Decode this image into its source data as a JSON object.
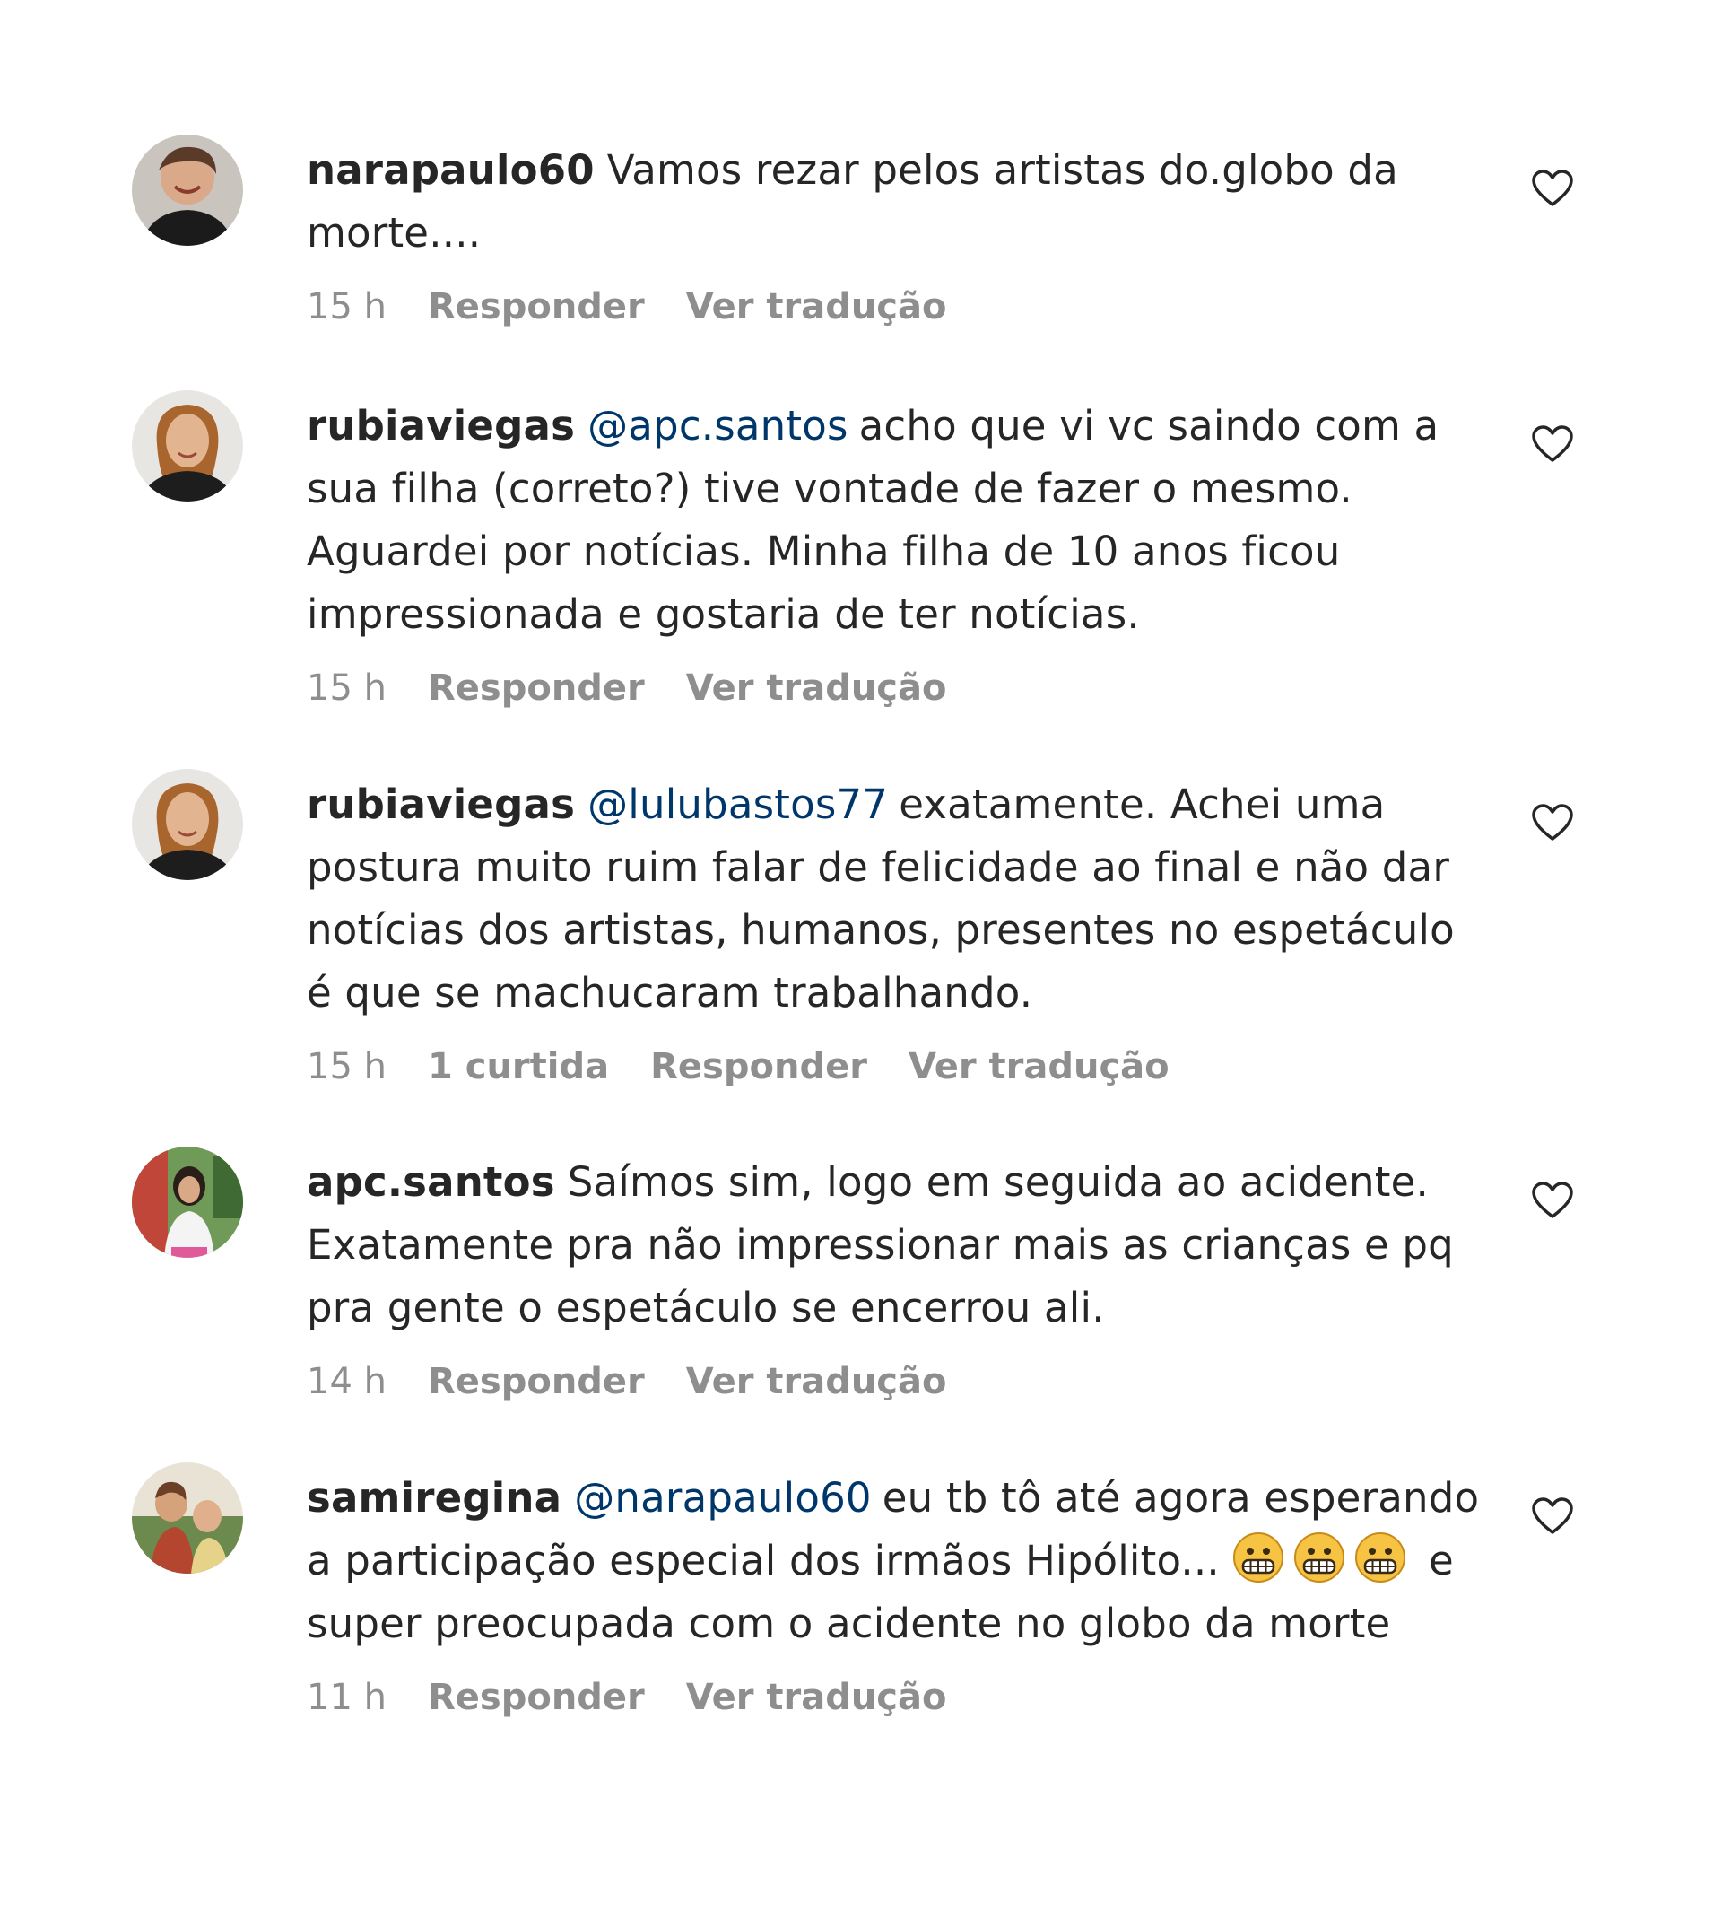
{
  "comments": [
    {
      "username": "narapaulo60",
      "mention": "",
      "text": "Vamos rezar pelos artistas do.globo da morte....",
      "time": "15 h",
      "likes": "",
      "reply_label": "Responder",
      "translate_label": "Ver tradução"
    },
    {
      "username": "rubiaviegas",
      "mention": "@apc.santos",
      "text": "acho que vi vc saindo com a sua filha (correto?) tive vontade de fazer o mesmo. Aguardei por notícias. Minha filha de 10 anos ficou impressionada e gostaria de ter notícias.",
      "time": "15 h",
      "likes": "",
      "reply_label": "Responder",
      "translate_label": "Ver tradução"
    },
    {
      "username": "rubiaviegas",
      "mention": "@lulubastos77",
      "text": "exatamente. Achei uma postura muito ruim falar de felicidade ao final e não dar notícias dos artistas, humanos, presentes no espetáculo é que se machucaram trabalhando.",
      "time": "15 h",
      "likes": "1 curtida",
      "reply_label": "Responder",
      "translate_label": "Ver tradução"
    },
    {
      "username": "apc.santos",
      "mention": "",
      "text": "Saímos sim, logo em seguida ao acidente. Exatamente pra não impressionar mais as crianças e pq pra gente o espetáculo se encerrou ali.",
      "time": "14 h",
      "likes": "",
      "reply_label": "Responder",
      "translate_label": "Ver tradução"
    },
    {
      "username": "samiregina",
      "mention": "@narapaulo60",
      "text_before": "eu tb tô até agora esperando a participação especial dos irmãos Hipólito...",
      "emoji": "grimacing-face",
      "emoji_count": 3,
      "text_after": "e super preocupada com o acidente no globo da morte",
      "time": "11 h",
      "likes": "",
      "reply_label": "Responder",
      "translate_label": "Ver tradução"
    }
  ],
  "icons": {
    "like": "heart-outline-icon",
    "emoji": "grimacing-face-icon"
  },
  "colors": {
    "text": "#262626",
    "secondary": "#8e8e8e",
    "mention": "#00376b",
    "background": "#ffffff"
  }
}
